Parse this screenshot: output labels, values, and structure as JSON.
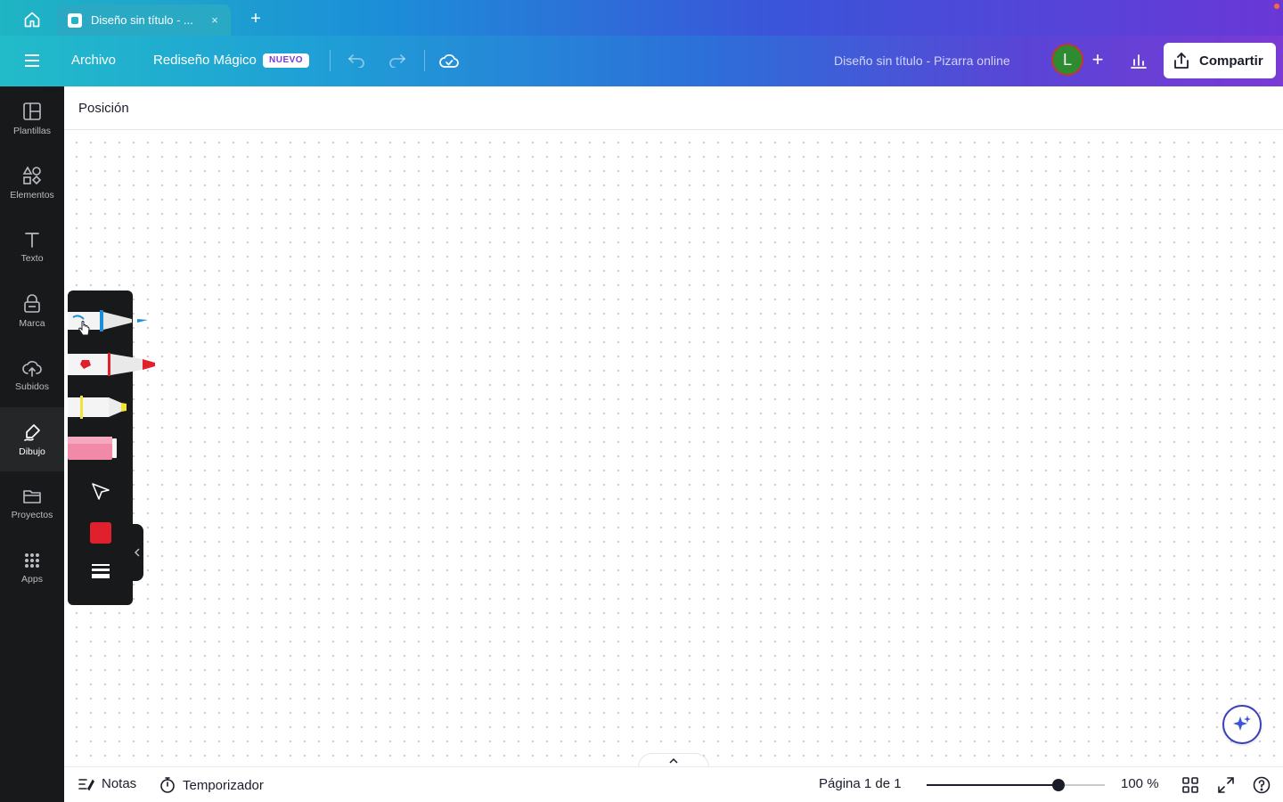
{
  "tabs": {
    "active_title": "Diseño sin título - ...",
    "close_glyph": "×",
    "new_tab_glyph": "+"
  },
  "header": {
    "archivo": "Archivo",
    "magic_redesign": "Rediseño Mágico",
    "badge": "NUEVO",
    "doc_title": "Diseño sin título - Pizarra online",
    "avatar_initial": "L",
    "add_glyph": "+",
    "share": "Compartir"
  },
  "sidebar": {
    "items": [
      {
        "label": "Plantillas",
        "icon": "templates-icon"
      },
      {
        "label": "Elementos",
        "icon": "elements-icon"
      },
      {
        "label": "Texto",
        "icon": "text-icon"
      },
      {
        "label": "Marca",
        "icon": "brand-icon"
      },
      {
        "label": "Subidos",
        "icon": "upload-cloud-icon"
      },
      {
        "label": "Dibujo",
        "icon": "draw-icon",
        "active": true
      },
      {
        "label": "Proyectos",
        "icon": "folder-icon"
      },
      {
        "label": "Apps",
        "icon": "apps-grid-icon"
      }
    ]
  },
  "context_bar": {
    "position": "Posición"
  },
  "draw_tools": {
    "tools": [
      "pen",
      "marker",
      "highlighter",
      "eraser",
      "select"
    ],
    "current_color": "#e0212d"
  },
  "footer": {
    "notes": "Notas",
    "timer": "Temporizador",
    "page_indicator": "Página 1 de 1",
    "zoom": "100 %",
    "zoom_level": 0.74
  },
  "colors": {
    "sidebar_bg": "#18191b",
    "accent_purple": "#7b3ad4",
    "pen_blue": "#1c8ed8",
    "marker_red": "#e0212d",
    "highlighter_yellow": "#f2e23a",
    "eraser_pink": "#f08aa8"
  }
}
